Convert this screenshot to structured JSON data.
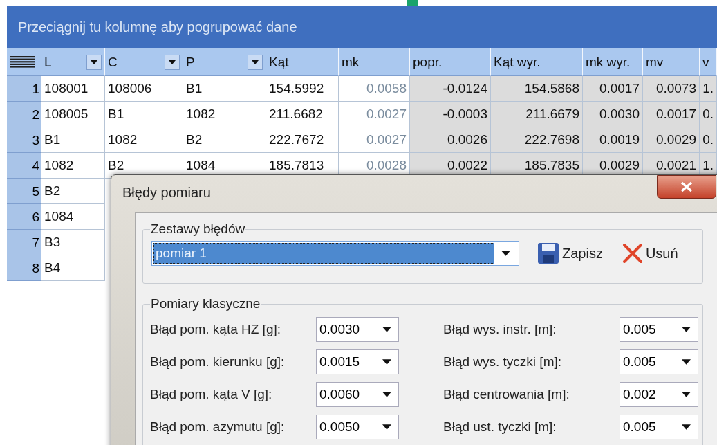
{
  "grid": {
    "group_panel": "Przeciągnij tu kolumnę aby pogrupować dane",
    "columns": [
      {
        "label": "L",
        "kind": "key",
        "filter": true
      },
      {
        "label": "C",
        "kind": "key",
        "filter": true
      },
      {
        "label": "P",
        "kind": "key",
        "filter": true
      },
      {
        "label": "Kąt",
        "kind": "key",
        "filter": false
      },
      {
        "label": "mk",
        "kind": "dim",
        "filter": false
      },
      {
        "label": "popr.",
        "kind": "computed",
        "filter": false
      },
      {
        "label": "Kąt wyr.",
        "kind": "computed",
        "filter": false
      },
      {
        "label": "mk wyr.",
        "kind": "computed",
        "filter": false
      },
      {
        "label": "mv",
        "kind": "computed",
        "filter": false
      },
      {
        "label": "v",
        "kind": "computed",
        "filter": false
      }
    ],
    "rows": [
      {
        "index": "1",
        "cells": [
          "108001",
          "108006",
          "B1",
          "154.5992",
          "0.0058",
          "-0.0124",
          "154.5868",
          "0.0017",
          "0.0073",
          "1."
        ]
      },
      {
        "index": "2",
        "cells": [
          "108005",
          "B1",
          "1082",
          "211.6682",
          "0.0027",
          "-0.0003",
          "211.6679",
          "0.0030",
          "0.0017",
          "0."
        ]
      },
      {
        "index": "3",
        "cells": [
          "B1",
          "1082",
          "B2",
          "222.7672",
          "0.0027",
          "0.0026",
          "222.7698",
          "0.0019",
          "0.0029",
          "0."
        ]
      },
      {
        "index": "4",
        "cells": [
          "1082",
          "B2",
          "1084",
          "185.7813",
          "0.0028",
          "0.0022",
          "185.7835",
          "0.0029",
          "0.0021",
          "1."
        ]
      },
      {
        "index": "5",
        "cells": [
          "B2"
        ]
      },
      {
        "index": "6",
        "cells": [
          "1084"
        ]
      },
      {
        "index": "7",
        "cells": [
          "B3"
        ]
      },
      {
        "index": "8",
        "cells": [
          "B4"
        ]
      }
    ]
  },
  "dialog": {
    "title": "Błędy pomiaru",
    "sets_group": {
      "title": "Zestawy błędów",
      "combo": {
        "value": "pomiar 1",
        "selected": true
      },
      "buttons": [
        {
          "label": "Zapisz",
          "kind": "save"
        },
        {
          "label": "Usuń",
          "kind": "delete"
        }
      ]
    },
    "classic_group": {
      "title": "Pomiary klasyczne",
      "left_fields": [
        {
          "label": "Błąd pom. kąta HZ [g]:",
          "value": "0.0030"
        },
        {
          "label": "Błąd pom. kierunku [g]:",
          "value": "0.0015"
        },
        {
          "label": "Błąd pom. kąta V [g]:",
          "value": "0.0060"
        },
        {
          "label": "Błąd pom. azymutu [g]:",
          "value": "0.0050"
        }
      ],
      "right_fields": [
        {
          "label": "Błąd wys. instr. [m]:",
          "value": "0.005"
        },
        {
          "label": "Błąd wys. tyczki [m]:",
          "value": "0.005"
        },
        {
          "label": "Błąd centrowania [m]:",
          "value": "0.002"
        },
        {
          "label": "Błąd ust. tyczki [m]:",
          "value": "0.005"
        }
      ]
    }
  }
}
